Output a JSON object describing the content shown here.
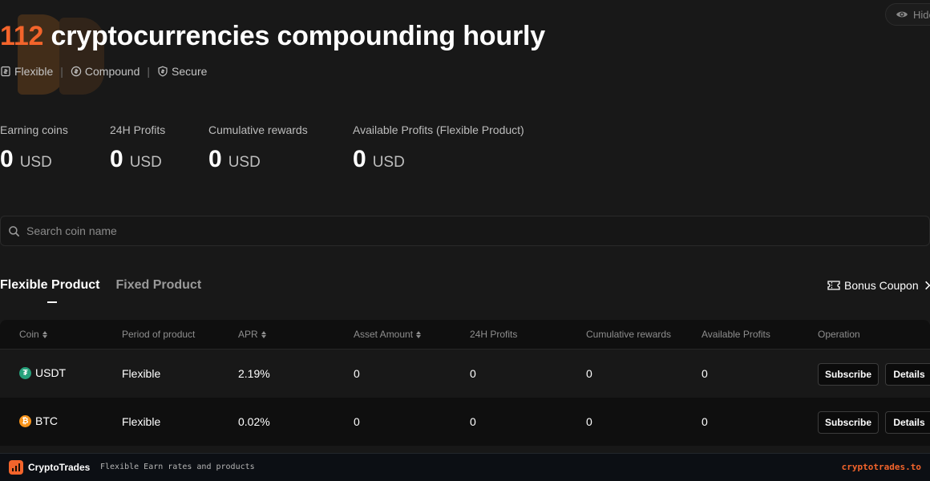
{
  "header": {
    "count": "112",
    "headline_rest": " cryptocurrencies compounding hourly",
    "hide_label": "Hide",
    "features": [
      {
        "icon": "wallet-icon",
        "label": "Flexible"
      },
      {
        "icon": "dollar-circle-icon",
        "label": "Compound"
      },
      {
        "icon": "shield-icon",
        "label": "Secure"
      }
    ]
  },
  "stats": [
    {
      "label": "Earning coins",
      "value": "0",
      "unit": "USD"
    },
    {
      "label": "24H Profits",
      "value": "0",
      "unit": "USD"
    },
    {
      "label": "Cumulative rewards",
      "value": "0",
      "unit": "USD"
    },
    {
      "label": "Available Profits (Flexible Product)",
      "value": "0",
      "unit": "USD"
    }
  ],
  "search": {
    "placeholder": "Search coin name",
    "value": ""
  },
  "tabs": [
    {
      "label": "Flexible Product",
      "active": true
    },
    {
      "label": "Fixed Product",
      "active": false
    }
  ],
  "bonus_coupon": "Bonus Coupon",
  "table": {
    "headers": [
      "Coin",
      "Period of product",
      "APR",
      "Asset Amount",
      "24H Profits",
      "Cumulative rewards",
      "Available Profits",
      "Operation"
    ],
    "rows": [
      {
        "coin": "USDT",
        "coin_glyph": "₮",
        "coin_color": "#26a17b",
        "period": "Flexible",
        "apr": "2.19%",
        "asset": "0",
        "profits24h": "0",
        "cumulative": "0",
        "available": "0",
        "subscribe": "Subscribe",
        "details": "Details"
      },
      {
        "coin": "BTC",
        "coin_glyph": "₿",
        "coin_color": "#f7931a",
        "period": "Flexible",
        "apr": "0.02%",
        "asset": "0",
        "profits24h": "0",
        "cumulative": "0",
        "available": "0",
        "subscribe": "Subscribe",
        "details": "Details"
      }
    ]
  },
  "footer": {
    "brand": "CryptoTrades",
    "tagline": "Flexible Earn rates and products",
    "domain": "cryptotrades.to"
  },
  "colors": {
    "accent": "#f3642b",
    "background": "#181818"
  }
}
